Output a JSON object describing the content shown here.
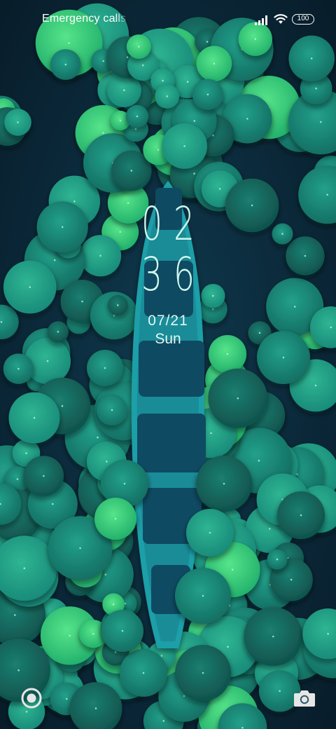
{
  "status_bar": {
    "carrier_text": "Emergency calls only",
    "battery_level": "100",
    "signal_icon": "signal-bars-icon",
    "wifi_icon": "wifi-icon"
  },
  "lock_screen": {
    "hour": "02",
    "minute": "36",
    "date": "07/21",
    "weekday": "Sun"
  },
  "shortcuts": {
    "left_icon": "circle-ring-icon",
    "right_icon": "camera-icon"
  },
  "colors": {
    "background": "#0a2535",
    "leaf_dark": "#1a7a6b",
    "leaf_mid": "#1f9a80",
    "leaf_bright": "#2ed47a",
    "boat": "#1f9fa8",
    "boat_seat": "#0f4a63",
    "clock_text": "#c9f7ee"
  }
}
